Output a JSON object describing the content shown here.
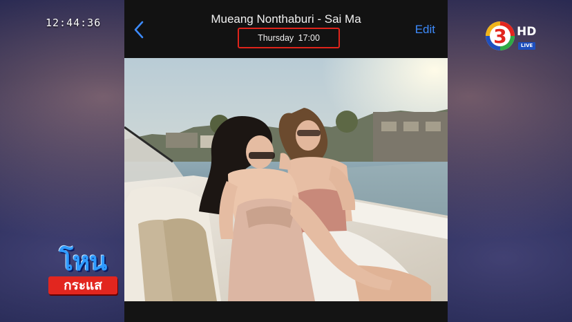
{
  "broadcast": {
    "clock": "12:44:36",
    "channel_number": "3",
    "channel_hd": "HD",
    "channel_live": "LIVE",
    "program_logo_line1": "โหน",
    "program_logo_line2": "กระแส"
  },
  "phone": {
    "nav": {
      "back_icon": "chevron-left-icon",
      "title": "Mueang Nonthaburi - Sai Ma",
      "subtitle": "Thursday  17:00",
      "edit_label": "Edit"
    },
    "highlight_color": "#e0241b",
    "accent_color": "#3d8bfd"
  }
}
